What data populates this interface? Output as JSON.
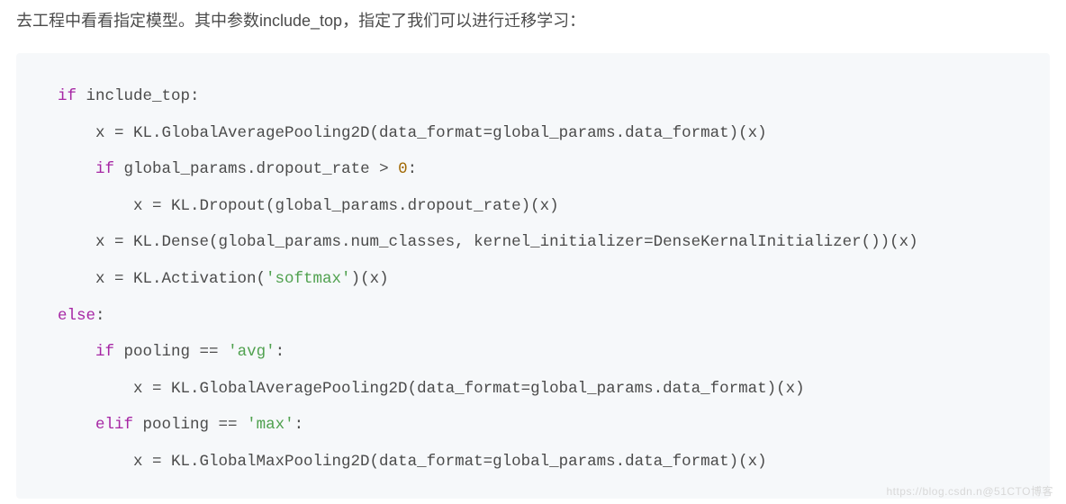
{
  "intro": "去工程中看看指定模型。其中参数include_top，指定了我们可以进行迁移学习：",
  "code": {
    "l1_kw": "if",
    "l1_rest": " include_top:",
    "l2": "    x = KL.GlobalAveragePooling2D(data_format=global_params.data_format)(x)",
    "l3_pre": "    ",
    "l3_kw": "if",
    "l3_mid": " global_params.dropout_rate > ",
    "l3_num": "0",
    "l3_end": ":",
    "l4": "        x = KL.Dropout(global_params.dropout_rate)(x)",
    "l5": "    x = KL.Dense(global_params.num_classes, kernel_initializer=DenseKernalInitializer())(x)",
    "l6_pre": "    x = KL.Activation(",
    "l6_str": "'softmax'",
    "l6_end": ")(x)",
    "l7_kw": "else",
    "l7_end": ":",
    "l8_pre": "    ",
    "l8_kw": "if",
    "l8_mid": " pooling == ",
    "l8_str": "'avg'",
    "l8_end": ":",
    "l9": "        x = KL.GlobalAveragePooling2D(data_format=global_params.data_format)(x)",
    "l10_pre": "    ",
    "l10_kw": "elif",
    "l10_mid": " pooling == ",
    "l10_str": "'max'",
    "l10_end": ":",
    "l11": "        x = KL.GlobalMaxPooling2D(data_format=global_params.data_format)(x)"
  },
  "watermark": "https://blog.csdn.n@51CTO博客"
}
